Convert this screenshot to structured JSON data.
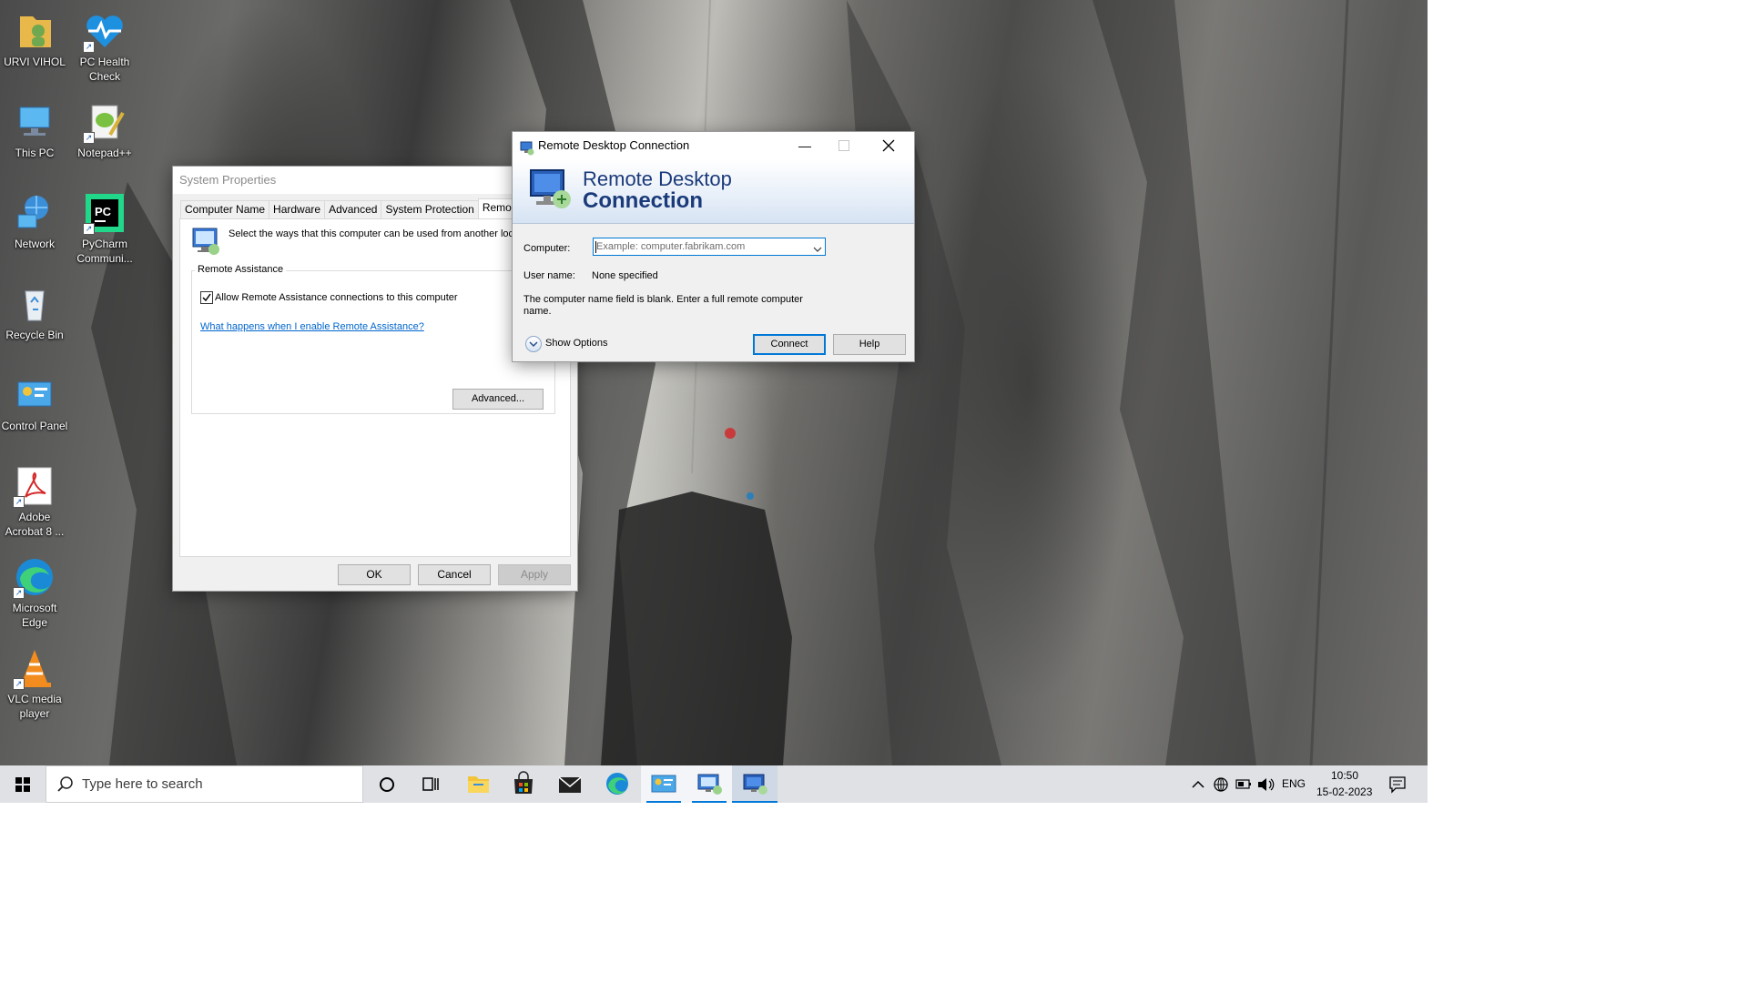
{
  "desktop": {
    "icons": [
      {
        "label": "URVI VIHOL"
      },
      {
        "label": "PC Health Check"
      },
      {
        "label": "This PC"
      },
      {
        "label": "Notepad++"
      },
      {
        "label": "Network"
      },
      {
        "label": "PyCharm Communi..."
      },
      {
        "label": "Recycle Bin"
      },
      {
        "label": "Control Panel"
      },
      {
        "label": "Adobe Acrobat 8 ..."
      },
      {
        "label": "Microsoft Edge"
      },
      {
        "label": "VLC media player"
      }
    ]
  },
  "system_properties": {
    "title": "System Properties",
    "tabs": [
      "Computer Name",
      "Hardware",
      "Advanced",
      "System Protection",
      "Remote"
    ],
    "active_tab": "Remote",
    "intro_text": "Select the ways that this computer can be used from another loca",
    "group_label": "Remote Assistance",
    "checkbox_label": "Allow Remote Assistance connections to this computer",
    "checkbox_checked": true,
    "link_text": "What happens when I enable Remote Assistance?",
    "advanced_button": "Advanced...",
    "ok_button": "OK",
    "cancel_button": "Cancel",
    "apply_button": "Apply"
  },
  "rdc": {
    "title": "Remote Desktop Connection",
    "banner_line1": "Remote Desktop",
    "banner_line2": "Connection",
    "computer_label": "Computer:",
    "computer_placeholder": "Example: computer.fabrikam.com",
    "username_label": "User name:",
    "username_value": "None specified",
    "message_line1": "The computer name field is blank. Enter a full remote computer",
    "message_line2": "name.",
    "show_options": "Show Options",
    "connect_button": "Connect",
    "help_button": "Help"
  },
  "taskbar": {
    "search_placeholder": "Type here to search",
    "language": "ENG",
    "time": "10:50",
    "date": "15-02-2023",
    "accent": "#0078d7"
  }
}
